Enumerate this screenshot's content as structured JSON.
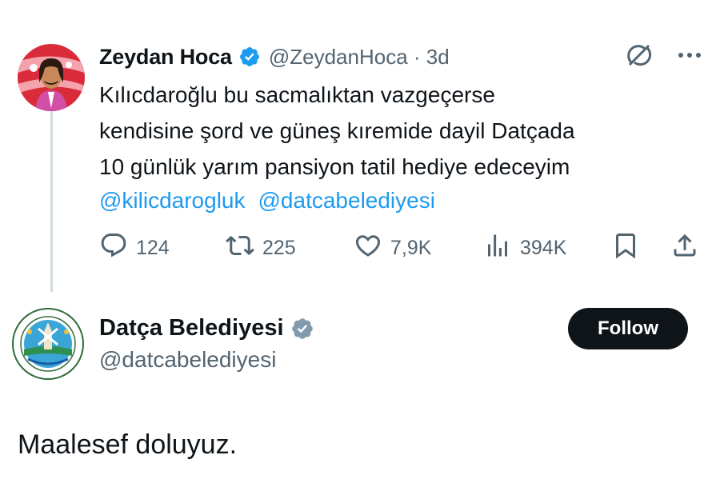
{
  "colors": {
    "link": "#1d9bf0",
    "secondary": "#536471",
    "verified_blue": "#1d9bf0",
    "verified_gray": "#829aab",
    "button_bg": "#0f1419"
  },
  "original_tweet": {
    "author_name": "Zeydan Hoca",
    "verified_icon": "verified-badge-blue-icon",
    "handle_time": "@ZeydanHoca · 3d",
    "text": "Kılıcdaroğlu bu sacmalıktan  vazgeçerse\nkendisine şord ve güneş kıremide dayil Datçada\n10 günlük yarım pansiyon tatil hediye edeceyim",
    "mentions": [
      "@kilicdarogluk",
      "@datcabelediyesi"
    ],
    "actions": {
      "replies": "124",
      "reposts": "225",
      "likes": "7,9K",
      "views": "394K"
    }
  },
  "reply_tweet": {
    "author_name": "Datça Belediyesi",
    "verified_icon": "verified-badge-gray-icon",
    "handle": "@datcabelediyesi",
    "follow_label": "Follow",
    "text": "Maalesef doluyuz."
  }
}
